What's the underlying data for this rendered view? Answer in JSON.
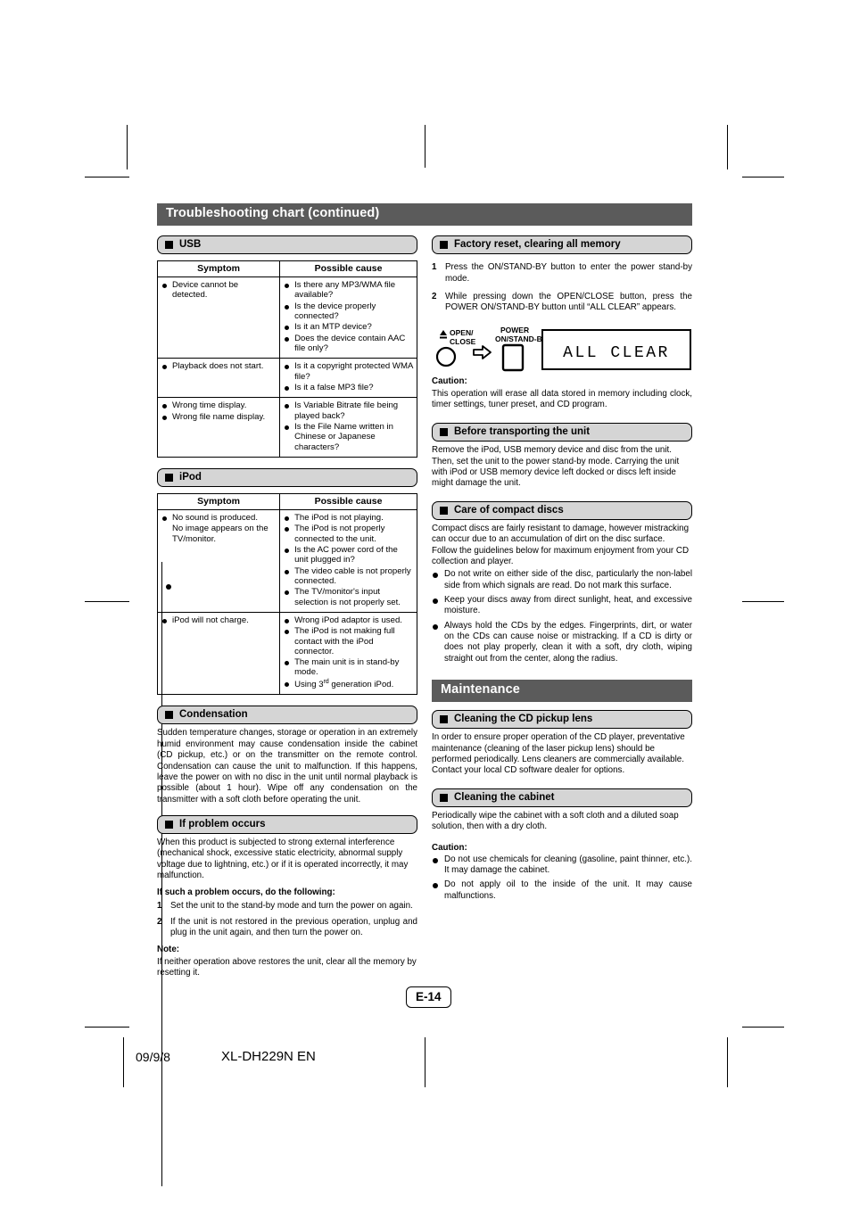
{
  "banner": {
    "title": "Troubleshooting chart (continued)"
  },
  "left": {
    "usb": {
      "heading": "USB",
      "columns": [
        "Symptom",
        "Possible cause"
      ],
      "rows": [
        {
          "symptom": [
            "Device cannot be detected."
          ],
          "cause": [
            "Is there any MP3/WMA file available?",
            "Is the device properly connected?",
            "Is it an MTP device?",
            "Does the device contain AAC file only?"
          ]
        },
        {
          "symptom": [
            "Playback does not start."
          ],
          "cause": [
            "Is it a copyright protected WMA file?",
            "Is it a false MP3 file?"
          ]
        },
        {
          "symptom": [
            "Wrong time display.",
            "Wrong file name display."
          ],
          "cause": [
            "Is Variable Bitrate file being played back?",
            "Is the File Name written in Chinese or Japanese characters?"
          ]
        }
      ]
    },
    "ipod": {
      "heading": "iPod",
      "columns": [
        "Symptom",
        "Possible cause"
      ],
      "rows": [
        {
          "symptom": [
            "No sound is produced.",
            "No image appears on the TV/monitor."
          ],
          "cause": [
            "The iPod is not playing.",
            "The iPod is not properly connected to the unit.",
            "Is the AC power cord of the unit plugged in?",
            "The video cable is not properly connected.",
            "The TV/monitor's input selection is not properly set."
          ]
        },
        {
          "symptom": [
            "iPod will not charge."
          ],
          "cause": [
            "Wrong iPod adaptor is used.",
            "The iPod is not making full contact with the iPod connector.",
            "The main unit is in stand-by mode.",
            "Using 3rd generation iPod."
          ]
        }
      ]
    },
    "condensation": {
      "heading": "Condensation",
      "text": "Sudden temperature changes, storage or operation in an extremely humid environment may cause condensation inside the cabinet (CD pickup, etc.) or on the transmitter on the remote control. Condensation can cause the unit to malfunction. If this happens, leave the power on with no disc in the unit until normal playback is possible (about 1 hour). Wipe off any condensation on the transmitter with a soft cloth before operating the unit."
    },
    "problem": {
      "heading": "If problem occurs",
      "text": "When this product is subjected to strong external interference (mechanical shock, excessive static electricity, abnormal supply voltage due to lightning, etc.) or if it is operated incorrectly, it may malfunction.",
      "lead": "If such a problem occurs, do the following:",
      "steps": [
        "Set the unit to the stand-by mode and turn the power on again.",
        "If the unit is not restored in the previous operation, unplug and plug in the unit again, and then turn the power on."
      ],
      "note_label": "Note:",
      "note_text": "If neither operation above restores the unit, clear all the memory by resetting it."
    }
  },
  "right": {
    "factory": {
      "heading": "Factory reset, clearing all memory",
      "steps": [
        "Press the ON/STAND-BY button to enter the power stand-by mode.",
        "While pressing down the OPEN/CLOSE button, press the POWER ON/STAND-BY button until “ALL CLEAR” appears."
      ],
      "diagram": {
        "open_close_label_line1": "OPEN/",
        "open_close_label_line2": "CLOSE",
        "power_label_line1": "POWER",
        "power_label_line2": "ON/STAND-BY",
        "display_text": "ALL CLEAR"
      },
      "caution_label": "Caution:",
      "caution_text": "This operation will erase all data stored in memory including clock, timer settings, tuner preset, and CD program."
    },
    "transport": {
      "heading": "Before transporting the unit",
      "text": "Remove the iPod, USB memory device and disc from the unit. Then, set the unit to the power stand-by mode. Carrying the unit with iPod or USB memory device left docked or discs left inside might damage the unit."
    },
    "care": {
      "heading": "Care of compact discs",
      "text": "Compact discs are fairly resistant to damage, however mistracking can occur due to an accumulation of dirt on the disc surface. Follow the guidelines below for maximum enjoyment from your CD collection and player.",
      "bullets": [
        "Do not write on either side of the disc, particularly the non-label side from which signals are read. Do not mark this surface.",
        "Keep your discs away from direct sunlight, heat, and excessive moisture.",
        "Always hold the CDs by the edges. Fingerprints, dirt, or water on the CDs can cause noise or mistracking. If a CD is dirty or does not play properly, clean it with a soft, dry cloth, wiping straight out from the center, along the radius."
      ]
    },
    "maintenance": {
      "banner": "Maintenance",
      "lens": {
        "heading": "Cleaning the CD pickup lens",
        "text": "In order to ensure proper operation of the CD player, preventative maintenance (cleaning of the laser pickup lens) should be performed periodically. Lens cleaners are commercially available. Contact your local CD software dealer for options."
      },
      "cabinet": {
        "heading": "Cleaning the cabinet",
        "text": "Periodically wipe the cabinet with a soft cloth and a diluted soap solution, then with a dry cloth.",
        "caution_label": "Caution:",
        "caution_bullets": [
          "Do not use chemicals for cleaning (gasoline, paint thinner, etc.). It may damage the cabinet.",
          "Do not apply oil to the inside of the unit. It may cause malfunctions."
        ]
      }
    }
  },
  "footer": {
    "page_number": "E-14",
    "date": "09/9/8",
    "model": "XL-DH229N EN"
  },
  "colors": {
    "banner_bg": "#5b5b5b",
    "subhead_bg": "#d5d5d5",
    "text": "#000000"
  }
}
